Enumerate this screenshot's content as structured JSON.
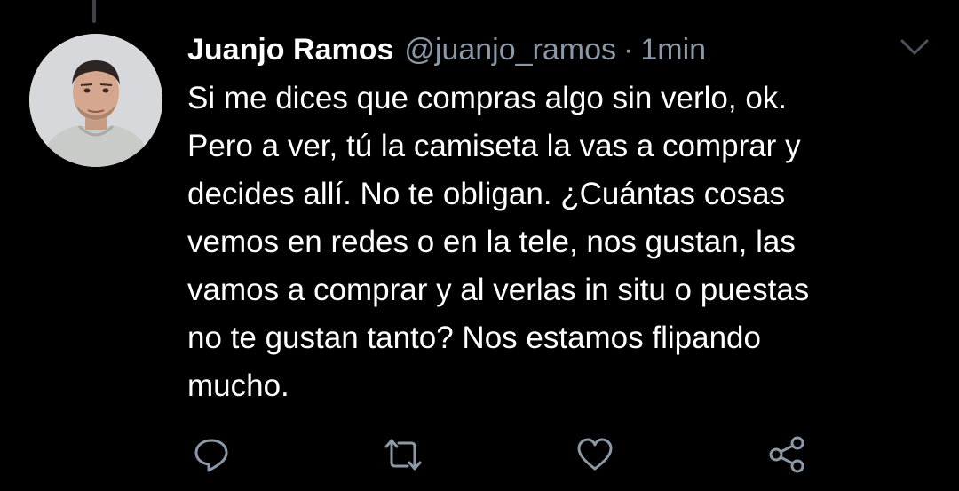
{
  "tweet": {
    "author_name": "Juanjo Ramos",
    "handle": "@juanjo_ramos",
    "separator": "·",
    "time": "1min",
    "text": "Si me dices que compras algo sin verlo, ok.\nPero a ver, tú la camiseta la vas a comprar y\ndecides allí. No te obligan. ¿Cuántas cosas\nvemos en redes o en la tele, nos gustan, las\nvamos a comprar y al verlas in situ o puestas\nno te gustan tanto? Nos estamos flipando\nmucho."
  },
  "icons": {
    "menu": "chevron-down-icon",
    "reply": "reply-bubble-icon",
    "retweet": "retweet-icon",
    "like": "heart-icon",
    "share": "share-icon"
  },
  "colors": {
    "background": "#000000",
    "primary_text": "#ffffff",
    "secondary_text": "#8b98a5"
  }
}
